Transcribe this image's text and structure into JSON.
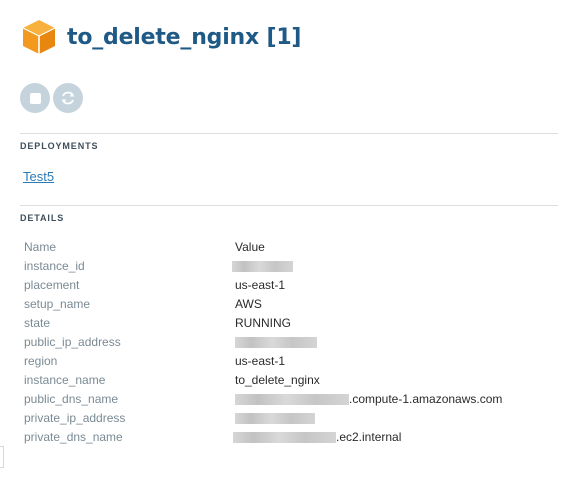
{
  "header": {
    "title": "to_delete_nginx [1]",
    "icon": "cube-icon",
    "icon_color": "#f39a1e",
    "title_color": "#1f5a86"
  },
  "actions": [
    {
      "name": "stop-button",
      "icon": "stop-icon"
    },
    {
      "name": "refresh-button",
      "icon": "refresh-icon"
    }
  ],
  "deployments": {
    "label": "DEPLOYMENTS",
    "items": [
      "Test5"
    ]
  },
  "details": {
    "label": "DETAILS",
    "header": {
      "key": "Name",
      "value": "Value"
    },
    "rows": [
      {
        "key": "instance_id",
        "value": "",
        "redacted": true
      },
      {
        "key": "placement",
        "value": "us-east-1"
      },
      {
        "key": "setup_name",
        "value": "AWS"
      },
      {
        "key": "state",
        "value": "RUNNING"
      },
      {
        "key": "public_ip_address",
        "value": "",
        "redacted": true
      },
      {
        "key": "region",
        "value": "us-east-1"
      },
      {
        "key": "instance_name",
        "value": "to_delete_nginx"
      },
      {
        "key": "public_dns_name",
        "value": ".compute-1.amazonaws.com",
        "redacted": true
      },
      {
        "key": "private_ip_address",
        "value": "",
        "redacted": true
      },
      {
        "key": "private_dns_name",
        "value": ".ec2.internal",
        "redacted": true
      }
    ]
  }
}
